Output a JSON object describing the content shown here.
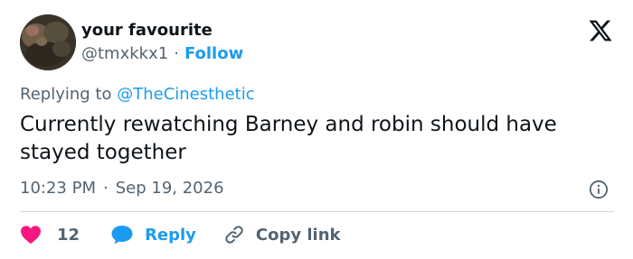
{
  "user": {
    "display_name": "your favourite",
    "handle": "@tmxkkx1",
    "separator": "·",
    "follow_label": "Follow",
    "avatar_icon": "avatar-photo"
  },
  "brand": {
    "logo_icon": "x-logo-icon"
  },
  "tweet": {
    "replying_prefix": "Replying to",
    "replying_to": "@TheCinesthetic",
    "text": "Currently rewatching Barney and robin should have stayed together",
    "time": "10:23 PM",
    "separator": "·",
    "date": "Sep 19, 2026"
  },
  "actions": {
    "like_count": "12",
    "reply_label": "Reply",
    "copy_label": "Copy link"
  },
  "colors": {
    "accent": "#1d9bf0",
    "like": "#f91880",
    "text": "#0f1419",
    "secondary": "#536471",
    "divider": "#cfd9de"
  }
}
